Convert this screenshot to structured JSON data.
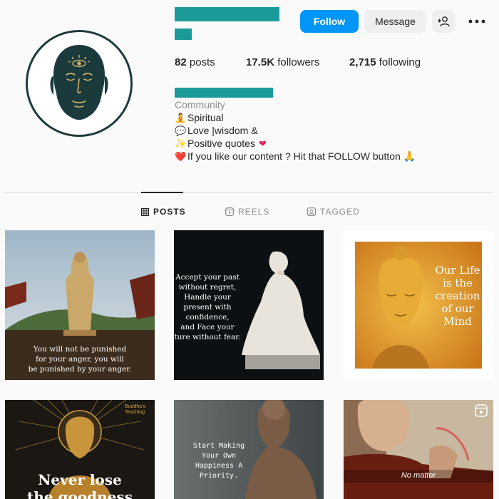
{
  "profile": {
    "follow_label": "Follow",
    "message_label": "Message",
    "stats": [
      {
        "value": "82",
        "label": "posts"
      },
      {
        "value": "17.5K",
        "label": "followers"
      },
      {
        "value": "2,715",
        "label": "following"
      }
    ],
    "category": "Community",
    "bio_lines": [
      {
        "emoji": "🧘",
        "text": "Spiritual"
      },
      {
        "emoji": "💬",
        "text": "Love |wisdom &"
      },
      {
        "emoji": "✨",
        "text": "Positive quotes"
      },
      {
        "emoji": "❤️",
        "text": "If you like our content ? Hit that FOLLOW button 🙏"
      }
    ]
  },
  "tabs": [
    {
      "label": "POSTS",
      "icon": "grid-icon",
      "active": true
    },
    {
      "label": "REELS",
      "icon": "reels-icon",
      "active": false
    },
    {
      "label": "TAGGED",
      "icon": "tagged-icon",
      "active": false
    }
  ],
  "posts": [
    {
      "caption_lines": [
        "You will not be punished",
        "for your anger, you will",
        "be punished by your anger."
      ]
    },
    {
      "caption_lines": [
        "Accept your past",
        "without regret,",
        "Handle your",
        "present with",
        "confidence,",
        "and Face your",
        "ture without fear."
      ]
    },
    {
      "caption_lines": [
        "Our Life",
        "is the",
        "creation",
        "of our",
        "Mind"
      ]
    },
    {
      "caption_lines": [
        "Never lose",
        "the goodness"
      ],
      "badge": "Buddha's Teaching"
    },
    {
      "caption_lines": [
        "Start Making",
        "Your Own",
        "Happiness A",
        "Priority."
      ]
    },
    {
      "caption_lines": [
        "No matter"
      ]
    }
  ],
  "colors": {
    "accent": "#0095f6",
    "redaction": "#1c9a9a"
  }
}
